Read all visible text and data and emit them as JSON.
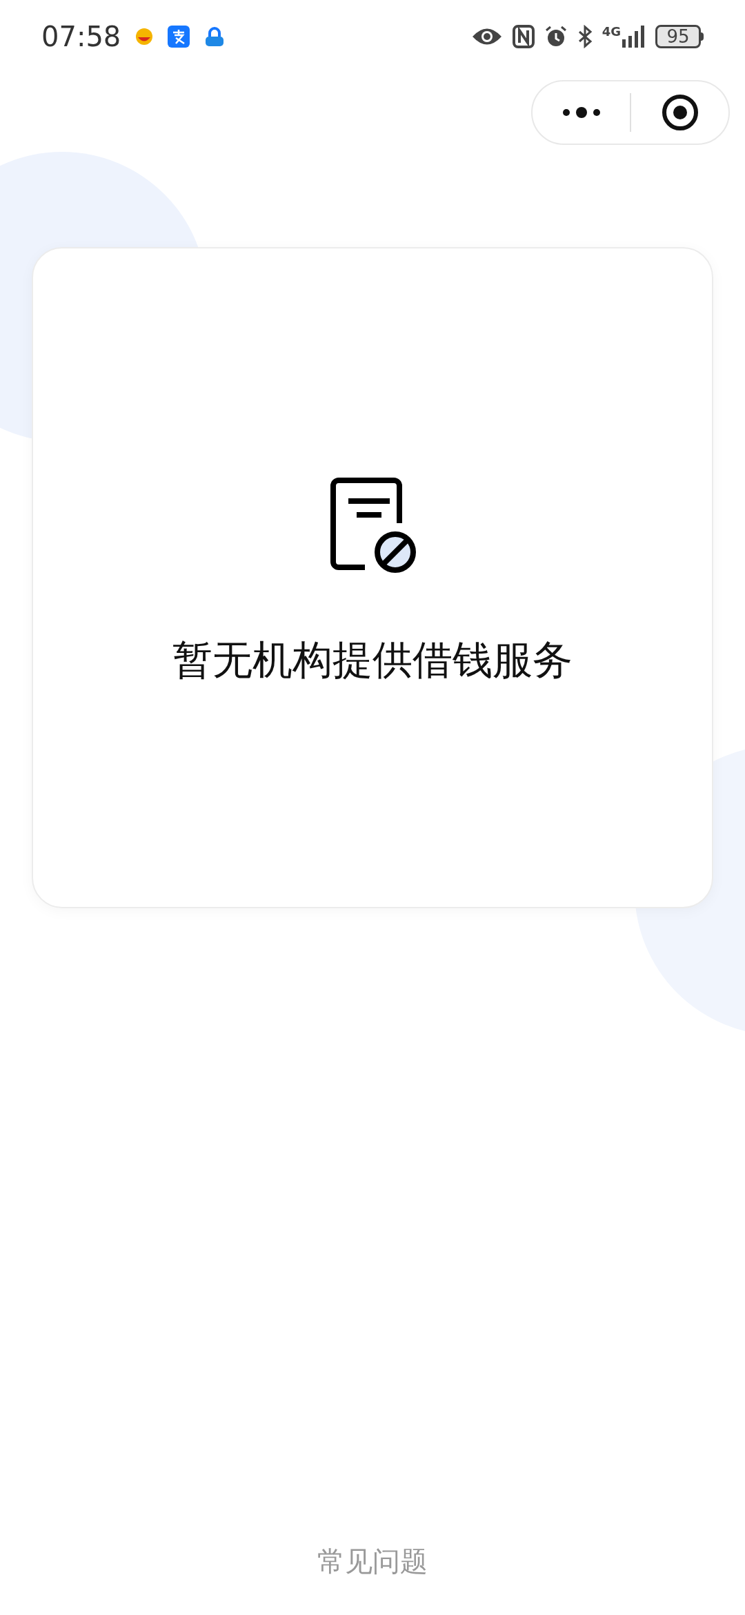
{
  "status_bar": {
    "time": "07:58",
    "network": "4G",
    "battery": "95"
  },
  "empty_state": {
    "message": "暂无机构提供借钱服务"
  },
  "footer_link": "常见问题"
}
